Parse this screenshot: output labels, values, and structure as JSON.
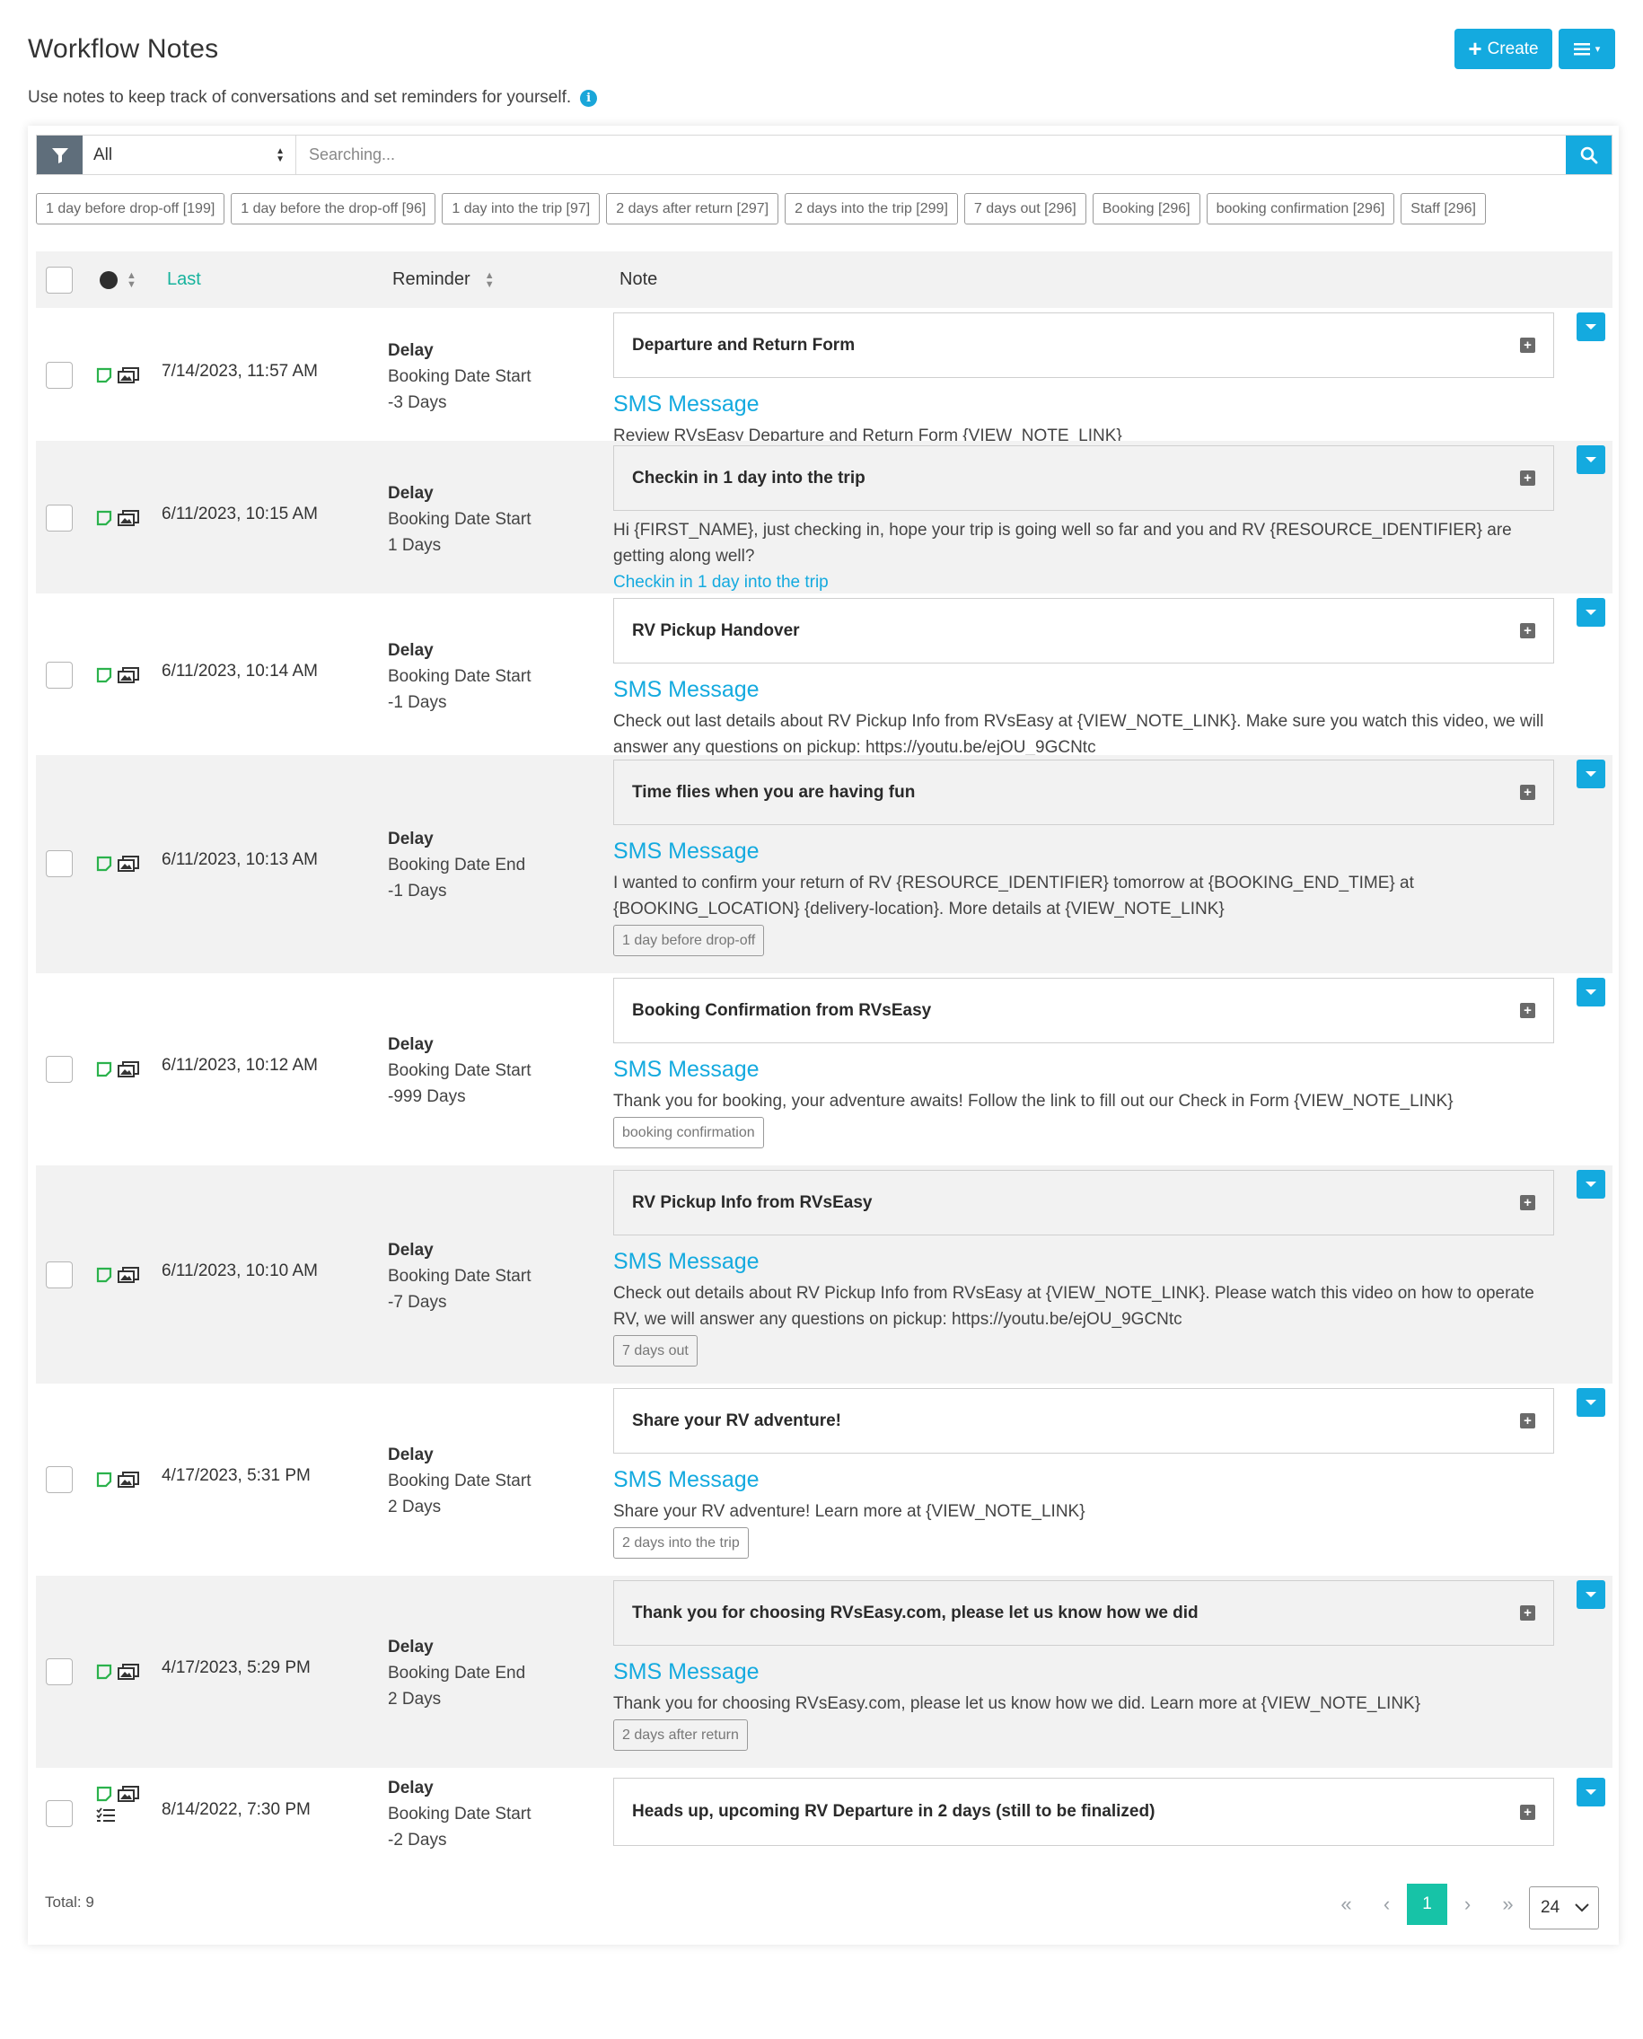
{
  "header": {
    "title": "Workflow Notes",
    "subtitle": "Use notes to keep track of conversations and set reminders for yourself.",
    "create_label": "Create"
  },
  "filter": {
    "selected": "All",
    "search_placeholder": "Searching..."
  },
  "tags": [
    "1 day before drop-off [199]",
    "1 day before the drop-off [96]",
    "1 day into the trip [97]",
    "2 days after return [297]",
    "2 days into the trip [299]",
    "7 days out [296]",
    "Booking [296]",
    "booking confirmation [296]",
    "Staff [296]"
  ],
  "columns": {
    "last": "Last",
    "reminder": "Reminder",
    "note": "Note"
  },
  "rows": [
    {
      "date": "7/14/2023, 11:57 AM",
      "reminder_type": "Delay",
      "reminder_base": "Booking Date Start",
      "reminder_offset": "-3 Days",
      "title": "Departure and Return Form",
      "note_type": "SMS Message",
      "text": "Review RVsEasy Departure and Return Form {VIEW_NOTE_LINK}"
    },
    {
      "date": "6/11/2023, 10:15 AM",
      "reminder_type": "Delay",
      "reminder_base": "Booking Date Start",
      "reminder_offset": "1 Days",
      "title": "Checkin in 1 day into the trip",
      "text": "Hi {FIRST_NAME}, just checking in, hope your trip is going well so far and you and RV {RESOURCE_IDENTIFIER} are getting along well?",
      "link": "Checkin in 1 day into the trip"
    },
    {
      "date": "6/11/2023, 10:14 AM",
      "reminder_type": "Delay",
      "reminder_base": "Booking Date Start",
      "reminder_offset": "-1 Days",
      "title": "RV Pickup Handover",
      "note_type": "SMS Message",
      "text": "Check out last details about RV Pickup Info from RVsEasy at {VIEW_NOTE_LINK}. Make sure you watch this video, we will answer any questions on pickup: https://youtu.be/ejOU_9GCNtc"
    },
    {
      "date": "6/11/2023, 10:13 AM",
      "reminder_type": "Delay",
      "reminder_base": "Booking Date End",
      "reminder_offset": "-1 Days",
      "title": "Time flies when you are having fun",
      "note_type": "SMS Message",
      "text": "I wanted to confirm your return of RV {RESOURCE_IDENTIFIER} tomorrow at {BOOKING_END_TIME} at {BOOKING_LOCATION} {delivery-location}. More details at {VIEW_NOTE_LINK}",
      "tag": "1 day before drop-off"
    },
    {
      "date": "6/11/2023, 10:12 AM",
      "reminder_type": "Delay",
      "reminder_base": "Booking Date Start",
      "reminder_offset": "-999 Days",
      "title": "Booking Confirmation from RVsEasy",
      "note_type": "SMS Message",
      "text": "Thank you for booking, your adventure awaits! Follow the link to fill out our Check in Form {VIEW_NOTE_LINK}",
      "tag": "booking confirmation"
    },
    {
      "date": "6/11/2023, 10:10 AM",
      "reminder_type": "Delay",
      "reminder_base": "Booking Date Start",
      "reminder_offset": "-7 Days",
      "title": "RV Pickup Info from RVsEasy",
      "note_type": "SMS Message",
      "text": "Check out details about RV Pickup Info from RVsEasy at {VIEW_NOTE_LINK}. Please watch this video on how to operate RV, we will answer any questions on pickup: https://youtu.be/ejOU_9GCNtc",
      "tag": "7 days out"
    },
    {
      "date": "4/17/2023, 5:31 PM",
      "reminder_type": "Delay",
      "reminder_base": "Booking Date Start",
      "reminder_offset": "2 Days",
      "title": "Share your RV adventure!",
      "note_type": "SMS Message",
      "text": "Share your RV adventure! Learn more at {VIEW_NOTE_LINK}",
      "tag": "2 days into the trip"
    },
    {
      "date": "4/17/2023, 5:29 PM",
      "reminder_type": "Delay",
      "reminder_base": "Booking Date End",
      "reminder_offset": "2 Days",
      "title": "Thank you for choosing RVsEasy.com, please let us know how we did",
      "note_type": "SMS Message",
      "text": "Thank you for choosing RVsEasy.com, please let us know how we did. Learn more at {VIEW_NOTE_LINK}",
      "tag": "2 days after return"
    },
    {
      "date": "8/14/2022, 7:30 PM",
      "reminder_type": "Delay",
      "reminder_base": "Booking Date Start",
      "reminder_offset": "-2 Days",
      "title": "Heads up, upcoming RV Departure in 2 days (still to be finalized)"
    }
  ],
  "footer": {
    "total": "Total: 9",
    "current_page": "1",
    "page_size": "24"
  },
  "colors": {
    "accent": "#14aadf",
    "active_page": "#17c3a7",
    "sort_active": "#17b39d",
    "row_alt": "#f2f2f2"
  }
}
